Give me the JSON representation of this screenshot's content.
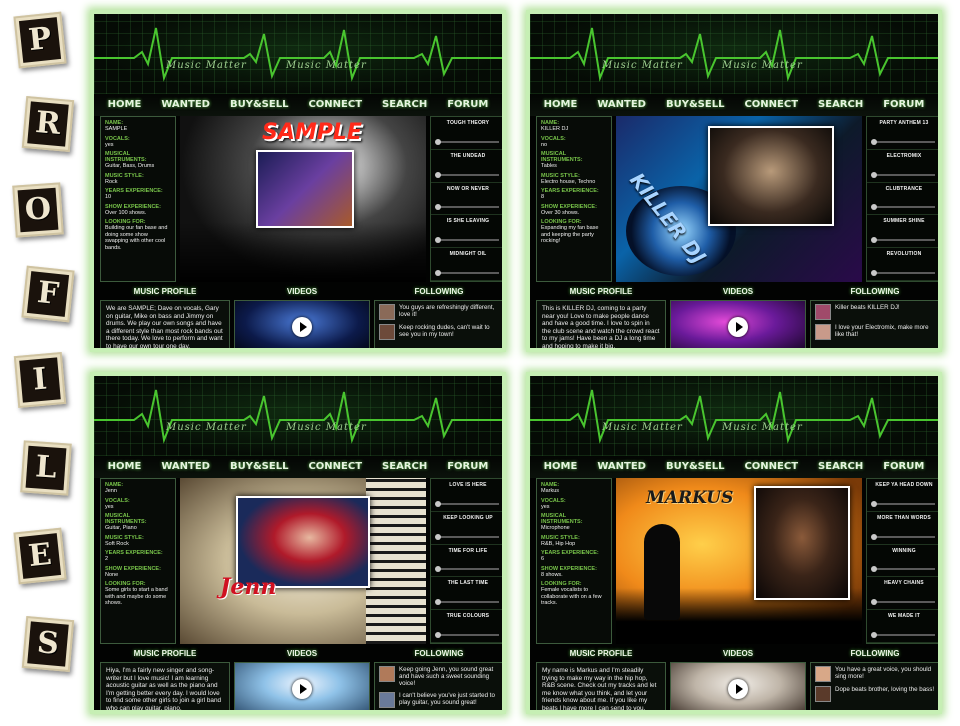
{
  "title_tiles": [
    "P",
    "R",
    "O",
    "F",
    "I",
    "L",
    "E",
    "S"
  ],
  "brand": {
    "logo": "Music Matter",
    "accent": "#49c52f",
    "glow": "#c6efb4"
  },
  "nav": [
    "HOME",
    "WANTED",
    "BUY&SELL",
    "CONNECT",
    "SEARCH",
    "FORUM"
  ],
  "labels": {
    "name": "NAME:",
    "vocals": "VOCALS:",
    "instruments": "MUSICAL INSTRUMENTS:",
    "style": "MUSIC STYLE:",
    "years": "YEARS EXPERIENCE:",
    "show": "SHOW EXPERIENCE:",
    "looking": "LOOKING FOR:",
    "music_profile": "MUSIC PROFILE",
    "videos": "VIDEOS",
    "following": "FOLLOWING"
  },
  "profiles": [
    {
      "name": "SAMPLE",
      "vocals": "yes",
      "instruments": "Guitar, Bass, Drums",
      "style": "Rock",
      "years": "10",
      "show": "Over 100 shows.",
      "looking": "Building our fan base and doing some show swapping with other cool bands.",
      "hero_title": "SAMPLE",
      "tracks": [
        "TOUGH THEORY",
        "THE UNDEAD",
        "NOW OR NEVER",
        "IS SHE LEAVING",
        "MIDNIGHT OIL"
      ],
      "profile_text": "We are SAMPLE; Dave on vocals, Gary on guitar, Mike on bass and Jimmy on drums. We play our own songs and have a different style than most rock bands out there today. We love to perform and want to have our own tour one day.",
      "comments": [
        "You guys are refreshingly different, love it!",
        "Keep rocking dudes, can't wait to see you in my town!"
      ]
    },
    {
      "name": "KILLER DJ",
      "vocals": "no",
      "instruments": "Tables",
      "style": "Electro house, Techno",
      "years": "8",
      "show": "Over 30 shows.",
      "looking": "Expanding my fan base and keeping the party rocking!",
      "hero_title": "KILLER DJ",
      "tracks": [
        "PARTY ANTHEM 13",
        "ELECTROMIX",
        "CLUBTRANCE",
        "SUMMER SHINE",
        "REVOLUTION"
      ],
      "profile_text": "This is KILLER DJ, coming to a party near you! Love to make people dance and have a good time. I love to spin in the club scene and watch the crowd react to my jams! Have been a DJ a long time and hoping to make it big.",
      "comments": [
        "Killer beats KILLER DJ!",
        "I love your Electromix, make more like that!"
      ]
    },
    {
      "name": "Jenn",
      "vocals": "yes",
      "instruments": "Guitar, Piano",
      "style": "Soft Rock",
      "years": "2",
      "show": "None",
      "looking": "Some girls to start a band with and maybe do some shows.",
      "hero_title": "Jenn",
      "tracks": [
        "LOVE IS HERE",
        "KEEP LOOKING UP",
        "TIME FOR LIFE",
        "THE LAST TIME",
        "TRUE COLOURS"
      ],
      "profile_text": "Hiya, I'm a fairly new singer and song-writer but I love music! I am learning acoustic guitar as well as the piano and I'm getting better every day. I would love to find some other girls to join a girl band who can play guitar, piano,",
      "comments": [
        "Keep going Jenn, you sound great and have such a sweet sounding voice!",
        "I can't believe you've just started to play guitar, you sound great!"
      ]
    },
    {
      "name": "Markus",
      "vocals": "yes",
      "instruments": "Microphone",
      "style": "R&B, Hip Hop",
      "years": "6",
      "show": "8 shows.",
      "looking": "Female vocalists to collaborate with on a few tracks.",
      "hero_title": "MARKUS",
      "tracks": [
        "KEEP YA HEAD DOWN",
        "MORE THAN WORDS",
        "WINNING",
        "HEAVY CHAINS",
        "WE MADE IT"
      ],
      "profile_text": "My name is Markus and I'm steadily trying to make my way in the hip hop, R&B scene. Check out my tracks and let me know what you think, and let your friends know about me. If you like my beats I have more I can send to you.",
      "comments": [
        "You have a great voice, you should sing more!",
        "Dope beats brother, loving the bass!"
      ]
    }
  ]
}
